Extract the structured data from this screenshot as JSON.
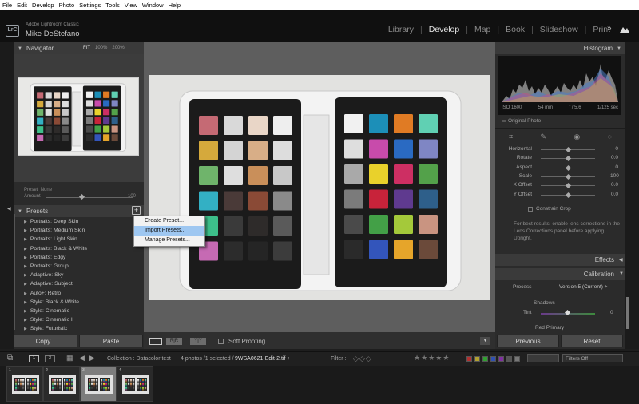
{
  "menubar": [
    "File",
    "Edit",
    "Develop",
    "Photo",
    "Settings",
    "Tools",
    "View",
    "Window",
    "Help"
  ],
  "identity": {
    "logo": "LrC",
    "product": "Adobe Lightroom Classic",
    "user": "Mike DeStefano",
    "modules": [
      {
        "label": "Library",
        "active": false
      },
      {
        "label": "Develop",
        "active": true
      },
      {
        "label": "Map",
        "active": false
      },
      {
        "label": "Book",
        "active": false
      },
      {
        "label": "Slideshow",
        "active": false
      },
      {
        "label": "Print",
        "active": false
      }
    ],
    "more": "»"
  },
  "navigator": {
    "title": "Navigator",
    "zoom": [
      "FIT",
      "100%",
      "200%"
    ],
    "preset_label": "Preset",
    "preset_value": "None",
    "amount_label": "Amount",
    "amount_value": "100"
  },
  "presets": {
    "title": "Presets",
    "plus": "+",
    "items": [
      "Portraits: Deep Skin",
      "Portraits: Medium Skin",
      "Portraits: Light Skin",
      "Portraits: Black & White",
      "Portraits: Edgy",
      "Portraits: Group",
      "Adaptive: Sky",
      "Adaptive: Subject",
      "Auto+: Retro",
      "Style: Black & White",
      "Style: Cinematic",
      "Style: Cinematic II",
      "Style: Futuristic"
    ]
  },
  "context_menu": {
    "items": [
      {
        "label": "Create Preset...",
        "highlighted": false
      },
      {
        "label": "Import Presets...",
        "highlighted": true
      },
      {
        "label": "Manage Presets...",
        "highlighted": false
      }
    ]
  },
  "left_buttons": {
    "copy": "Copy...",
    "paste": "Paste"
  },
  "toolbar": {
    "ab": "R|R",
    "yy": "Y|Y",
    "soft_proofing": "Soft Proofing"
  },
  "histogram": {
    "title": "Histogram",
    "iso": "ISO 1600",
    "focal": "54 mm",
    "aperture": "f / 5.6",
    "shutter": "1/125 sec",
    "original_photo": "Original Photo"
  },
  "transform": {
    "rows": [
      {
        "label": "Horizontal",
        "value": "0",
        "pos": 0.5
      },
      {
        "label": "Rotate",
        "value": "0.0",
        "pos": 0.5
      },
      {
        "label": "Aspect",
        "value": "0",
        "pos": 0.5
      },
      {
        "label": "Scale",
        "value": "100",
        "pos": 0.5
      },
      {
        "label": "X Offset",
        "value": "0.0",
        "pos": 0.5
      },
      {
        "label": "Y Offset",
        "value": "0.0",
        "pos": 0.5
      }
    ],
    "constrain_crop": "Constrain Crop",
    "note": "For best results, enable lens corrections in the Lens Corrections panel before applying Upright."
  },
  "effects": {
    "title": "Effects"
  },
  "calibration": {
    "title": "Calibration",
    "process_label": "Process",
    "process_value": "Version 5 (Current) ÷",
    "shadows": "Shadows",
    "tint_label": "Tint",
    "tint_value": "0",
    "red_primary": "Red Primary"
  },
  "right_buttons": {
    "previous": "Previous",
    "reset": "Reset"
  },
  "filmstrip": {
    "page1": "1",
    "page2": "2",
    "collection": "Collection : Datacolor test",
    "count": "4 photos /1 selected /",
    "filename": "9WSA0621-Edit-2.tif",
    "filename_suffix": " ÷",
    "filter_label": "Filter :",
    "filters_off": "Filters Off",
    "thumbs": [
      {
        "num": "1",
        "selected": false
      },
      {
        "num": "2",
        "selected": false
      },
      {
        "num": "3",
        "selected": true
      },
      {
        "num": "4",
        "selected": false
      }
    ]
  },
  "chart_colors": {
    "left_card": [
      "#c56a74",
      "#d9d9d9",
      "#e9d6c7",
      "#eeeeee",
      "#d5a93c",
      "#d4d4d4",
      "#d8ae87",
      "#dddddd",
      "#6fb46b",
      "#dedede",
      "#c98f5a",
      "#c8c8c8",
      "#33b0c4",
      "#4a3a38",
      "#8a4a36",
      "#8a8a8a",
      "#3dbf8a",
      "#3a3a3a",
      "#2e2b2a",
      "#5a5a5a",
      "#c66ab3",
      "#2c2c2c",
      "#252525",
      "#3c3c3c"
    ],
    "right_card": [
      "#f1f1f1",
      "#1c8fb8",
      "#e07b24",
      "#60d0b3",
      "#dedede",
      "#c84bab",
      "#2a6ac2",
      "#7f86c4",
      "#a9a9a9",
      "#e9d12b",
      "#cd2f63",
      "#53a14a",
      "#7b7b7b",
      "#c8233a",
      "#5f3a8f",
      "#2e5f8a",
      "#4a4a4a",
      "#43a047",
      "#a4c93a",
      "#c99481",
      "#2a2a2a",
      "#3355bb",
      "#e6a52a",
      "#6b4a3a"
    ]
  }
}
